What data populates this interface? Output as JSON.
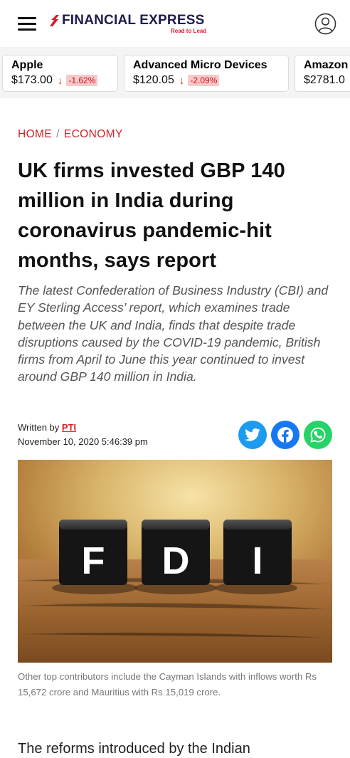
{
  "header": {
    "brand": "FINANCIAL EXPRESS",
    "tagline": "Read to Lead",
    "brand_color": "#1c1c4e",
    "accent_color": "#d32027",
    "menu_icon": "hamburger-icon",
    "profile_icon": "user-circle-icon"
  },
  "ticker": [
    {
      "name": "Apple",
      "price": "$173.00",
      "change": "-1.62%",
      "direction": "down"
    },
    {
      "name": "Advanced Micro Devices",
      "price": "$120.05",
      "change": "-2.09%",
      "direction": "down"
    },
    {
      "name": "Amazon",
      "price": "$2781.0",
      "change": "",
      "direction": ""
    }
  ],
  "breadcrumb": {
    "home": "HOME",
    "separator": "/",
    "section": "ECONOMY"
  },
  "article": {
    "headline": "UK firms invested GBP 140 million in India during coronavirus pandemic-hit months, says report",
    "summary": "The latest Confederation of Business Industry (CBI) and EY Sterling Access’ report, which examines trade between the UK and India, finds that despite trade disruptions caused by the COVID-19 pandemic, British firms from April to June this year continued to invest around GBP 140 million in India.",
    "written_by_label": "Written by",
    "author": "PTI",
    "timestamp": "November 10, 2020 5:46:39 pm",
    "share": [
      {
        "network": "twitter",
        "icon": "twitter-icon",
        "color": "#1d9bf0"
      },
      {
        "network": "facebook",
        "icon": "facebook-icon",
        "color": "#1877f2"
      },
      {
        "network": "whatsapp",
        "icon": "whatsapp-icon",
        "color": "#25d366"
      }
    ],
    "image_text": [
      "F",
      "D",
      "I"
    ],
    "caption": "Other top contributors include the Cayman Islands with inflows worth Rs 15,672 crore and Mauritius with Rs 15,019 crore.",
    "body_start": "The reforms introduced by the Indian"
  }
}
